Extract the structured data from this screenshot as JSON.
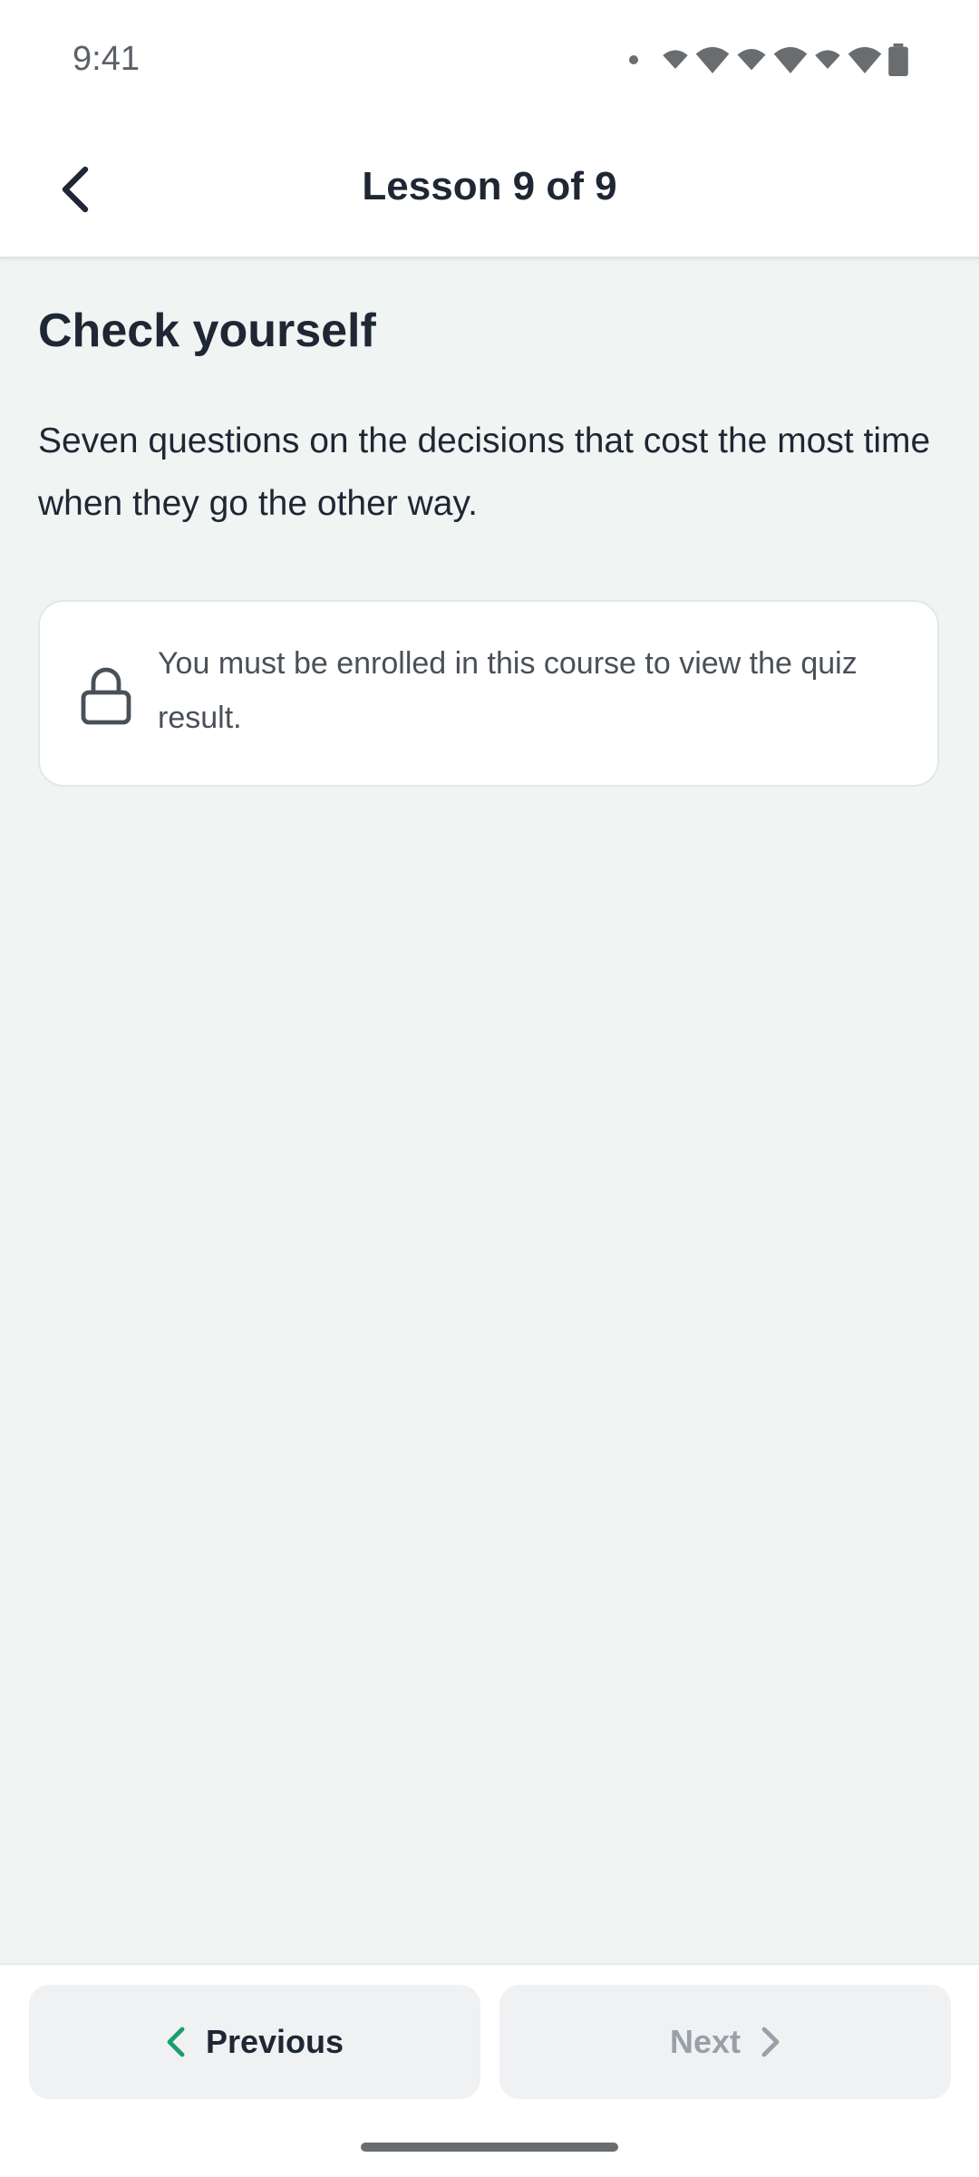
{
  "status_bar": {
    "time": "9:41",
    "icons": [
      "notification-dot-icon",
      "wifi-icon",
      "wifi-icon",
      "wifi-icon",
      "wifi-icon",
      "wifi-icon",
      "wifi-icon",
      "battery-icon"
    ]
  },
  "header": {
    "title": "Lesson 9 of 9",
    "back_icon": "chevron-left-icon"
  },
  "main": {
    "title": "Check yourself",
    "description": "Seven questions on the decisions that cost the most time when they go the other way.",
    "notice": {
      "icon": "lock-icon",
      "text": "You must be enrolled in this course to view the quiz result."
    }
  },
  "footer": {
    "previous_label": "Previous",
    "next_label": "Next",
    "previous_icon": "chevron-left-icon",
    "next_icon": "chevron-right-icon"
  },
  "colors": {
    "page_background": "#f0f5f3",
    "accent": "#1a9e6e",
    "text_primary": "#1e2733",
    "text_disabled": "#9aa0a8"
  }
}
